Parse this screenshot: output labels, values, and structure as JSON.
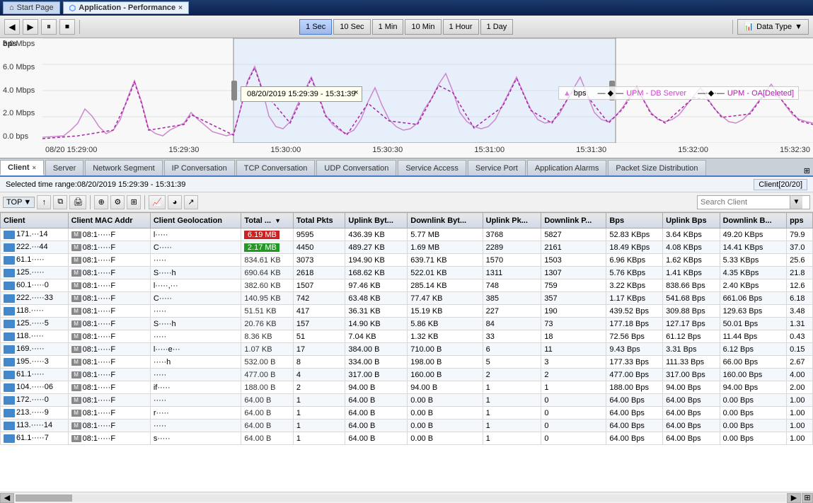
{
  "titlebar": {
    "start_tab_label": "Start Page",
    "active_tab_label": "Application - Performance",
    "close_btn": "×"
  },
  "toolbar": {
    "time_buttons": [
      "1 Sec",
      "10 Sec",
      "1 Min",
      "10 Min",
      "1 Hour",
      "1 Day"
    ],
    "active_time": "1 Sec",
    "data_type_label": "Data Type",
    "tooltip_time": "08/20/2019  15:29:39 - 15:31:39",
    "bps_label": "bps",
    "chart_header": "bps"
  },
  "chart": {
    "y_labels": [
      "8.0 Mbps",
      "6.0 Mbps",
      "4.0 Mbps",
      "2.0 Mbps",
      "0.0 bps"
    ],
    "x_labels": [
      "08/20 15:29:00",
      "15:29:30",
      "15:30:00",
      "15:30:30",
      "15:31:00",
      "15:31:30",
      "15:32:00",
      "15:32:30"
    ],
    "legend": [
      {
        "label": "bps",
        "color": "#cc88cc"
      },
      {
        "label": "UPM - DB Server",
        "color": "#cc44cc"
      },
      {
        "label": "UPM - OA[Deleted]",
        "color": "#aa22aa"
      }
    ]
  },
  "tabs": {
    "items": [
      {
        "label": "Client",
        "active": true,
        "closable": true
      },
      {
        "label": "Server",
        "active": false
      },
      {
        "label": "Network Segment",
        "active": false
      },
      {
        "label": "IP Conversation",
        "active": false
      },
      {
        "label": "TCP Conversation",
        "active": false
      },
      {
        "label": "UDP Conversation",
        "active": false
      },
      {
        "label": "Service Access",
        "active": false
      },
      {
        "label": "Service Port",
        "active": false
      },
      {
        "label": "Application Alarms",
        "active": false
      },
      {
        "label": "Packet Size Distribution",
        "active": false
      }
    ]
  },
  "infobar": {
    "selected_range": "Selected time range:08/20/2019 15:29:39 - 15:31:39",
    "count": "Client[20/20]"
  },
  "subtoolbar": {
    "search_placeholder": "Search Client"
  },
  "table": {
    "columns": [
      "Client",
      "Client MAC Addr",
      "Client Geolocation",
      "Total ...",
      "Total Pkts",
      "Uplink Byt...",
      "Downlink Byt...",
      "Uplink Pk...",
      "Downlink P...",
      "Bps",
      "Uplink Bps",
      "Downlink B...",
      "pps"
    ],
    "rows": [
      {
        "client": "171.···14",
        "mac": "08:1·····F",
        "geo": "l·····",
        "total": "6.19 MB",
        "total_bar": true,
        "bar_color": "red",
        "pkts": "9595",
        "up_bytes": "436.39 KB",
        "down_bytes": "5.77 MB",
        "up_pkts": "3768",
        "down_pkts": "5827",
        "bps": "52.83 KBps",
        "up_bps": "3.64 KBps",
        "down_bps": "49.20 KBps",
        "pps": "79.9"
      },
      {
        "client": "222.···44",
        "mac": "08:1·····F",
        "geo": "C·····",
        "total": "2.17 MB",
        "total_bar": true,
        "bar_color": "green",
        "pkts": "4450",
        "up_bytes": "489.27 KB",
        "down_bytes": "1.69 MB",
        "up_pkts": "2289",
        "down_pkts": "2161",
        "bps": "18.49 KBps",
        "up_bps": "4.08 KBps",
        "down_bps": "14.41 KBps",
        "pps": "37.0"
      },
      {
        "client": "61.1·····",
        "mac": "08:1·····F",
        "geo": "·····",
        "total": "834.61 KB",
        "total_bar": false,
        "pkts": "3073",
        "up_bytes": "194.90 KB",
        "down_bytes": "639.71 KB",
        "up_pkts": "1570",
        "down_pkts": "1503",
        "bps": "6.96 KBps",
        "up_bps": "1.62 KBps",
        "down_bps": "5.33 KBps",
        "pps": "25.6"
      },
      {
        "client": "125.·····",
        "mac": "08:1·····F",
        "geo": "S·····h",
        "total": "690.64 KB",
        "total_bar": false,
        "pkts": "2618",
        "up_bytes": "168.62 KB",
        "down_bytes": "522.01 KB",
        "up_pkts": "1311",
        "down_pkts": "1307",
        "bps": "5.76 KBps",
        "up_bps": "1.41 KBps",
        "down_bps": "4.35 KBps",
        "pps": "21.8"
      },
      {
        "client": "60.1·····0",
        "mac": "08:1·····F",
        "geo": "l·····,···",
        "total": "382.60 KB",
        "total_bar": false,
        "pkts": "1507",
        "up_bytes": "97.46 KB",
        "down_bytes": "285.14 KB",
        "up_pkts": "748",
        "down_pkts": "759",
        "bps": "3.22 KBps",
        "up_bps": "838.66 Bps",
        "down_bps": "2.40 KBps",
        "pps": "12.6"
      },
      {
        "client": "222.·····33",
        "mac": "08:1·····F",
        "geo": "C·····",
        "total": "140.95 KB",
        "total_bar": false,
        "pkts": "742",
        "up_bytes": "63.48 KB",
        "down_bytes": "77.47 KB",
        "up_pkts": "385",
        "down_pkts": "357",
        "bps": "1.17 KBps",
        "up_bps": "541.68 Bps",
        "down_bps": "661.06 Bps",
        "pps": "6.18"
      },
      {
        "client": "118.·····",
        "mac": "08:1·····F",
        "geo": "·····",
        "total": "51.51 KB",
        "total_bar": false,
        "pkts": "417",
        "up_bytes": "36.31 KB",
        "down_bytes": "15.19 KB",
        "up_pkts": "227",
        "down_pkts": "190",
        "bps": "439.52 Bps",
        "up_bps": "309.88 Bps",
        "down_bps": "129.63 Bps",
        "pps": "3.48"
      },
      {
        "client": "125.·····5",
        "mac": "08:1·····F",
        "geo": "S·····h",
        "total": "20.76 KB",
        "total_bar": false,
        "pkts": "157",
        "up_bytes": "14.90 KB",
        "down_bytes": "5.86 KB",
        "up_pkts": "84",
        "down_pkts": "73",
        "bps": "177.18 Bps",
        "up_bps": "127.17 Bps",
        "down_bps": "50.01 Bps",
        "pps": "1.31"
      },
      {
        "client": "118.·····",
        "mac": "08:1·····F",
        "geo": "·····",
        "total": "8.36 KB",
        "total_bar": false,
        "pkts": "51",
        "up_bytes": "7.04 KB",
        "down_bytes": "1.32 KB",
        "up_pkts": "33",
        "down_pkts": "18",
        "bps": "72.56 Bps",
        "up_bps": "61.12 Bps",
        "down_bps": "11.44 Bps",
        "pps": "0.43"
      },
      {
        "client": "169.·····",
        "mac": "08:1·····F",
        "geo": "l·····e···",
        "total": "1.07 KB",
        "total_bar": false,
        "pkts": "17",
        "up_bytes": "384.00 B",
        "down_bytes": "710.00 B",
        "up_pkts": "6",
        "down_pkts": "11",
        "bps": "9.43 Bps",
        "up_bps": "3.31 Bps",
        "down_bps": "6.12 Bps",
        "pps": "0.15"
      },
      {
        "client": "195.·····3",
        "mac": "08:1·····F",
        "geo": "·····h",
        "total": "532.00 B",
        "total_bar": false,
        "pkts": "8",
        "up_bytes": "334.00 B",
        "down_bytes": "198.00 B",
        "up_pkts": "5",
        "down_pkts": "3",
        "bps": "177.33 Bps",
        "up_bps": "111.33 Bps",
        "down_bps": "66.00 Bps",
        "pps": "2.67"
      },
      {
        "client": "61.1·····",
        "mac": "08:1·····F",
        "geo": "·····",
        "total": "477.00 B",
        "total_bar": false,
        "pkts": "4",
        "up_bytes": "317.00 B",
        "down_bytes": "160.00 B",
        "up_pkts": "2",
        "down_pkts": "2",
        "bps": "477.00 Bps",
        "up_bps": "317.00 Bps",
        "down_bps": "160.00 Bps",
        "pps": "4.00"
      },
      {
        "client": "104.·····06",
        "mac": "08:1·····F",
        "geo": "if·····",
        "total": "188.00 B",
        "total_bar": false,
        "pkts": "2",
        "up_bytes": "94.00 B",
        "down_bytes": "94.00 B",
        "up_pkts": "1",
        "down_pkts": "1",
        "bps": "188.00 Bps",
        "up_bps": "94.00 Bps",
        "down_bps": "94.00 Bps",
        "pps": "2.00"
      },
      {
        "client": "172.·····0",
        "mac": "08:1·····F",
        "geo": "·····",
        "total": "64.00 B",
        "total_bar": false,
        "pkts": "1",
        "up_bytes": "64.00 B",
        "down_bytes": "0.00 B",
        "up_pkts": "1",
        "down_pkts": "0",
        "bps": "64.00 Bps",
        "up_bps": "64.00 Bps",
        "down_bps": "0.00 Bps",
        "pps": "1.00"
      },
      {
        "client": "213.·····9",
        "mac": "08:1·····F",
        "geo": "r·····",
        "total": "64.00 B",
        "total_bar": false,
        "pkts": "1",
        "up_bytes": "64.00 B",
        "down_bytes": "0.00 B",
        "up_pkts": "1",
        "down_pkts": "0",
        "bps": "64.00 Bps",
        "up_bps": "64.00 Bps",
        "down_bps": "0.00 Bps",
        "pps": "1.00"
      },
      {
        "client": "113.·····14",
        "mac": "08:1·····F",
        "geo": "·····",
        "total": "64.00 B",
        "total_bar": false,
        "pkts": "1",
        "up_bytes": "64.00 B",
        "down_bytes": "0.00 B",
        "up_pkts": "1",
        "down_pkts": "0",
        "bps": "64.00 Bps",
        "up_bps": "64.00 Bps",
        "down_bps": "0.00 Bps",
        "pps": "1.00"
      },
      {
        "client": "61.1·····7",
        "mac": "08:1·····F",
        "geo": "s·····",
        "total": "64.00 B",
        "total_bar": false,
        "pkts": "1",
        "up_bytes": "64.00 B",
        "down_bytes": "0.00 B",
        "up_pkts": "1",
        "down_pkts": "0",
        "bps": "64.00 Bps",
        "up_bps": "64.00 Bps",
        "down_bps": "0.00 Bps",
        "pps": "1.00"
      }
    ]
  }
}
